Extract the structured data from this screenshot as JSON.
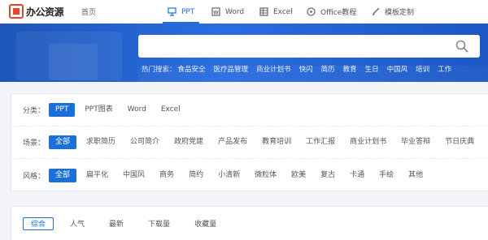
{
  "brand": {
    "logo_text": "办公资源",
    "accent": "#1a6fd8",
    "logo_color": "#e8412c"
  },
  "nav": {
    "home": "首页",
    "items": [
      {
        "label": "PPT",
        "icon": "presentation-icon",
        "active": true
      },
      {
        "label": "Word",
        "icon": "word-doc-icon",
        "active": false
      },
      {
        "label": "Excel",
        "icon": "spreadsheet-icon",
        "active": false
      },
      {
        "label": "Office教程",
        "icon": "play-circle-icon",
        "active": false
      },
      {
        "label": "模板定制",
        "icon": "brush-icon",
        "active": false
      }
    ]
  },
  "search": {
    "placeholder": "",
    "icon": "search-icon",
    "hot_label": "热门搜索：",
    "hot_keywords": [
      "食品安全",
      "医疗品管理",
      "商业计划书",
      "快闪",
      "简历",
      "教育",
      "生日",
      "中国风",
      "培训",
      "工作"
    ]
  },
  "filters": {
    "category": {
      "label": "分类：",
      "options": [
        "PPT",
        "PPT图表",
        "Word",
        "Excel"
      ],
      "selected": 0
    },
    "scene": {
      "label": "场景：",
      "options": [
        "全部",
        "求职简历",
        "公司简介",
        "政府党建",
        "产品发布",
        "教育培训",
        "工作汇报",
        "商业计划书",
        "毕业答辩",
        "节日庆典"
      ],
      "selected": 0
    },
    "style": {
      "label": "风格：",
      "options": [
        "全部",
        "扁平化",
        "中国风",
        "商务",
        "简约",
        "小清新",
        "微粒体",
        "欧美",
        "复古",
        "卡通",
        "手绘",
        "其他"
      ],
      "selected": 0
    }
  },
  "sort": {
    "options": [
      "综合",
      "人气",
      "最新",
      "下载量",
      "收藏量"
    ],
    "selected": 0
  }
}
